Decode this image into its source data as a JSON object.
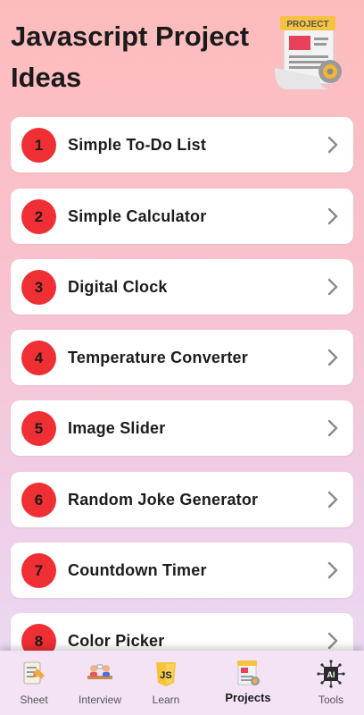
{
  "header": {
    "title": "Javascript Project Ideas",
    "illustration_text": "PROJECT"
  },
  "projects": [
    {
      "number": "1",
      "label": "Simple To-Do List"
    },
    {
      "number": "2",
      "label": "Simple Calculator"
    },
    {
      "number": "3",
      "label": "Digital Clock"
    },
    {
      "number": "4",
      "label": "Temperature Converter"
    },
    {
      "number": "5",
      "label": "Image Slider"
    },
    {
      "number": "6",
      "label": "Random Joke Generator"
    },
    {
      "number": "7",
      "label": "Countdown Timer"
    },
    {
      "number": "8",
      "label": "Color Picker"
    }
  ],
  "nav": {
    "items": [
      {
        "label": "Sheet",
        "icon": "sheet-icon"
      },
      {
        "label": "Interview",
        "icon": "interview-icon"
      },
      {
        "label": "Learn",
        "icon": "js-learn-icon",
        "icon_text": "JS"
      },
      {
        "label": "Projects",
        "icon": "projects-icon",
        "active": true
      },
      {
        "label": "Tools",
        "icon": "ai-tools-icon",
        "icon_text": "AI"
      }
    ]
  },
  "colors": {
    "accent": "#ef2f33",
    "chevron": "#8a8a8a"
  }
}
